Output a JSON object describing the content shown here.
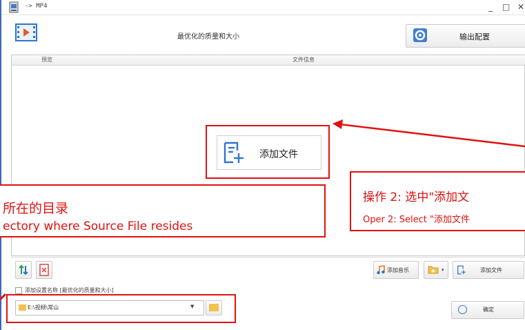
{
  "window": {
    "title": "-> MP4",
    "minimize_glyph": "_",
    "maximize_glyph": "□",
    "close_glyph": "✕"
  },
  "header": {
    "preset_label": "最优化的质量和大小",
    "output_config_label": "输出配置"
  },
  "file_list": {
    "columns": [
      "预览",
      "文件信息"
    ],
    "add_file_big_label": "添加文件"
  },
  "callouts": {
    "left_line1": "所在的目录",
    "left_line2": "ectory where Source File resides",
    "right_line1": "操作 2:  选中\"添加文",
    "right_line2": "Oper 2: Select \"添加文件"
  },
  "bottom_toolbar": {
    "add_music_label": "添加音乐",
    "add_file_label": "添加文件"
  },
  "settings": {
    "add_setting_name_label": "添加设置名称 [最优化的质量和大小]",
    "output_path": "E:\\视频\\常山",
    "ok_label": "确定"
  },
  "colors": {
    "annotation_red": "#e01010",
    "window_border": "#3d68b8",
    "icon_blue": "#2e76c9",
    "folder_yellow": "#f2c14e"
  }
}
